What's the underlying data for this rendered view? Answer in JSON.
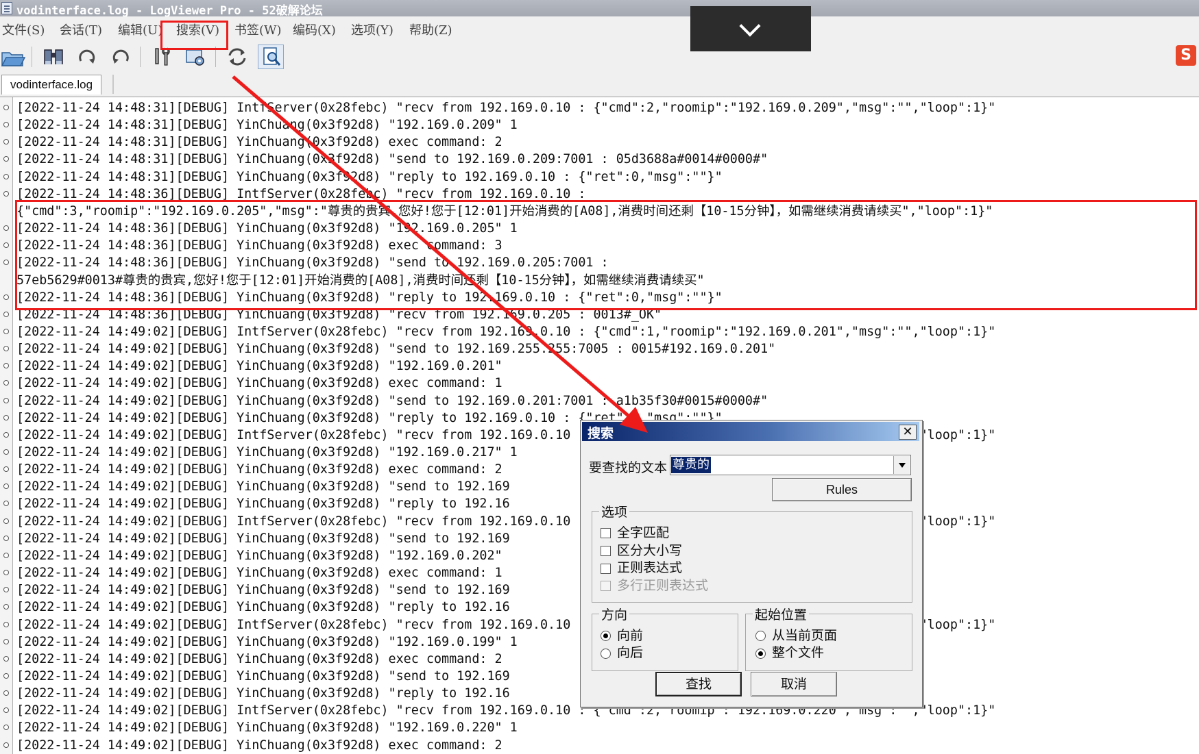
{
  "window": {
    "title": "vodinterface.log - LogViewer Pro - 52破解论坛"
  },
  "menu": {
    "items": [
      "文件(S)",
      "会话(T)",
      "编辑(U)",
      "搜索(V)",
      "书签(W)",
      "编码(X)",
      "选项(Y)",
      "帮助(Z)"
    ]
  },
  "toolbar": {
    "icons": [
      "open-folder-icon",
      "binoculars-icon",
      "redo-icon",
      "undo-icon",
      "tools-icon",
      "settings-icon",
      "refresh-icon",
      "find-document-icon"
    ]
  },
  "tabs": {
    "file_tab": "vodinterface.log"
  },
  "log_lines": [
    "[2022-11-24 14:48:31][DEBUG] IntfServer(0x28febc) \"recv from 192.169.0.10 : {\"cmd\":2,\"roomip\":\"192.169.0.209\",\"msg\":\"\",\"loop\":1}\"",
    "[2022-11-24 14:48:31][DEBUG] YinChuang(0x3f92d8) \"192.169.0.209\" 1",
    "[2022-11-24 14:48:31][DEBUG] YinChuang(0x3f92d8) exec command: 2",
    "[2022-11-24 14:48:31][DEBUG] YinChuang(0x3f92d8) \"send to 192.169.0.209:7001 : 05d3688a#0014#0000#\"",
    "[2022-11-24 14:48:31][DEBUG] YinChuang(0x3f92d8) \"reply to 192.169.0.10 : {\"ret\":0,\"msg\":\"\"}\"",
    "[2022-11-24 14:48:36][DEBUG] IntfServer(0x28febc) \"recv from 192.169.0.10 :",
    "{\"cmd\":3,\"roomip\":\"192.169.0.205\",\"msg\":\"尊贵的贵宾,您好!您于[12:01]开始消费的[A08],消费时间还剩【10-15分钟】，如需继续消费请续买\",\"loop\":1}\"",
    "[2022-11-24 14:48:36][DEBUG] YinChuang(0x3f92d8) \"192.169.0.205\" 1",
    "[2022-11-24 14:48:36][DEBUG] YinChuang(0x3f92d8) exec command: 3",
    "[2022-11-24 14:48:36][DEBUG] YinChuang(0x3f92d8) \"send to 192.169.0.205:7001 :",
    "57eb5629#0013#尊贵的贵宾,您好!您于[12:01]开始消费的[A08],消费时间还剩【10-15分钟】，如需继续消费请续买\"",
    "[2022-11-24 14:48:36][DEBUG] YinChuang(0x3f92d8) \"reply to 192.169.0.10 : {\"ret\":0,\"msg\":\"\"}\"",
    "[2022-11-24 14:48:36][DEBUG] YinChuang(0x3f92d8) \"recv from 192.169.0.205 : 0013#_OK\"",
    "[2022-11-24 14:49:02][DEBUG] IntfServer(0x28febc) \"recv from 192.169.0.10 : {\"cmd\":1,\"roomip\":\"192.169.0.201\",\"msg\":\"\",\"loop\":1}\"",
    "[2022-11-24 14:49:02][DEBUG] YinChuang(0x3f92d8) \"send to 192.169.255.255:7005 : 0015#192.169.0.201\"",
    "[2022-11-24 14:49:02][DEBUG] YinChuang(0x3f92d8) \"192.169.0.201\"",
    "[2022-11-24 14:49:02][DEBUG] YinChuang(0x3f92d8) exec command: 1",
    "[2022-11-24 14:49:02][DEBUG] YinChuang(0x3f92d8) \"send to 192.169.0.201:7001 : a1b35f30#0015#0000#\"",
    "[2022-11-24 14:49:02][DEBUG] YinChuang(0x3f92d8) \"reply to 192.169.0.10 : {\"ret\":0,\"msg\":\"\"}\"",
    "[2022-11-24 14:49:02][DEBUG] IntfServer(0x28febc) \"recv from 192.169.0.10 : {\"cmd\":2,\"roomip\":\"192.169.0.217\",\"msg\":\"\",\"loop\":1}\"",
    "[2022-11-24 14:49:02][DEBUG] YinChuang(0x3f92d8) \"192.169.0.217\" 1",
    "[2022-11-24 14:49:02][DEBUG] YinChuang(0x3f92d8) exec command: 2",
    "[2022-11-24 14:49:02][DEBUG] YinChuang(0x3f92d8) \"send to 192.169",
    "[2022-11-24 14:49:02][DEBUG] YinChuang(0x3f92d8) \"reply to 192.16",
    "[2022-11-24 14:49:02][DEBUG] IntfServer(0x28febc) \"recv from 192.169.0.10 : {\"cmd\":1,\"roomip\":\"192.169.0.202\",\"msg\":\"\",\"loop\":1}\"",
    "[2022-11-24 14:49:02][DEBUG] YinChuang(0x3f92d8) \"send to 192.169",
    "[2022-11-24 14:49:02][DEBUG] YinChuang(0x3f92d8) \"192.169.0.202\"",
    "[2022-11-24 14:49:02][DEBUG] YinChuang(0x3f92d8) exec command: 1",
    "[2022-11-24 14:49:02][DEBUG] YinChuang(0x3f92d8) \"send to 192.169",
    "[2022-11-24 14:49:02][DEBUG] YinChuang(0x3f92d8) \"reply to 192.16",
    "[2022-11-24 14:49:02][DEBUG] IntfServer(0x28febc) \"recv from 192.169.0.10 : {\"cmd\":2,\"roomip\":\"192.169.0.199\",\"msg\":\"\",\"loop\":1}\"",
    "[2022-11-24 14:49:02][DEBUG] YinChuang(0x3f92d8) \"192.169.0.199\" 1",
    "[2022-11-24 14:49:02][DEBUG] YinChuang(0x3f92d8) exec command: 2",
    "[2022-11-24 14:49:02][DEBUG] YinChuang(0x3f92d8) \"send to 192.169",
    "[2022-11-24 14:49:02][DEBUG] YinChuang(0x3f92d8) \"reply to 192.16",
    "[2022-11-24 14:49:02][DEBUG] IntfServer(0x28febc) \"recv from 192.169.0.10 : {\"cmd\":2,\"roomip\":\"192.169.0.220\",\"msg\":\"\",\"loop\":1}\"",
    "[2022-11-24 14:49:02][DEBUG] YinChuang(0x3f92d8) \"192.169.0.220\" 1",
    "[2022-11-24 14:49:02][DEBUG] YinChuang(0x3f92d8) exec command: 2"
  ],
  "search_dialog": {
    "title": "搜索",
    "find_label": "要查找的文本",
    "find_value": "尊贵的",
    "rules_button": "Rules",
    "options_group": "选项",
    "opt_whole_word": "全字匹配",
    "opt_match_case": "区分大小写",
    "opt_regex": "正则表达式",
    "opt_multiline_regex": "多行正则表达式",
    "direction_group": "方向",
    "dir_forward": "向前",
    "dir_backward": "向后",
    "start_group": "起始位置",
    "start_current_page": "从当前页面",
    "start_whole_file": "整个文件",
    "find_button": "查找",
    "cancel_button": "取消",
    "close_glyph": "✕"
  },
  "colors": {
    "highlight_red": "#ee1b1b",
    "dialog_title_start": "#0a246a",
    "selection_bg": "#0a246a"
  }
}
